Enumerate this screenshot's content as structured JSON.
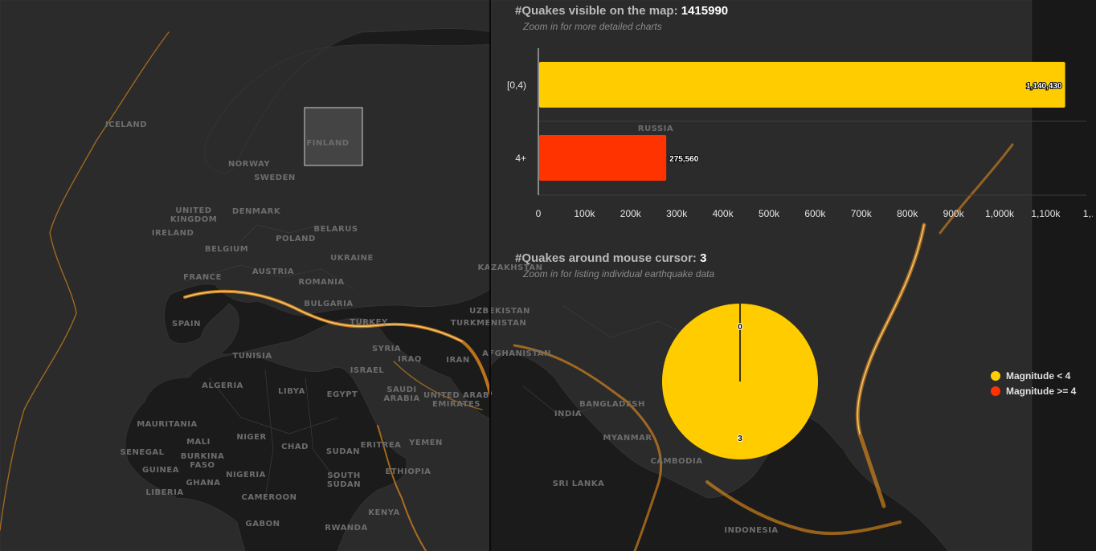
{
  "map": {
    "country_labels": [
      "ICELAND",
      "FINLAND",
      "NORWAY",
      "SWEDEN",
      "RUSSIA",
      "UNITED KINGDOM",
      "IRELAND",
      "DENMARK",
      "BELARUS",
      "POLAND",
      "BELGIUM",
      "UKRAINE",
      "FRANCE",
      "AUSTRIA",
      "ROMANIA",
      "BULGARIA",
      "SPAIN",
      "TURKEY",
      "TUNISIA",
      "SYRIA",
      "IRAQ",
      "IRAN",
      "ISRAEL",
      "ALGERIA",
      "LIBYA",
      "EGYPT",
      "SAUDI ARABIA",
      "UNITED ARAB EMIRATES",
      "MAURITANIA",
      "MALI",
      "NIGER",
      "CHAD",
      "SUDAN",
      "ERITREA",
      "YEMEN",
      "SENEGAL",
      "GUINEA",
      "BURKINA FASO",
      "GHANA",
      "NIGERIA",
      "ETHIOPIA",
      "SOUTH SUDAN",
      "LIBERIA",
      "CAMEROON",
      "KENYA",
      "GABON",
      "RWANDA",
      "KAZAKHSTAN",
      "UZBEKISTAN",
      "TURKMENISTAN",
      "AFGHANISTAN",
      "INDIA",
      "BANGLADESH",
      "MYANMAR",
      "CAMBODIA",
      "SRI LANKA",
      "INDONESIA"
    ],
    "colors": {
      "land": "#2b2b2b",
      "ocean": "#1b1b1b",
      "quake_glow": "#ff9a1a"
    }
  },
  "bar_panel": {
    "title_prefix": "#Quakes visible on the map: ",
    "title_count": "1415990",
    "subtitle": "Zoom in for more detailed charts"
  },
  "pie_panel": {
    "title_prefix": "#Quakes around mouse cursor: ",
    "title_count": "3",
    "subtitle": "Zoom in for listing individual earthquake data"
  },
  "chart_data": [
    {
      "type": "bar",
      "orientation": "horizontal",
      "categories": [
        "[0,4)",
        "4+"
      ],
      "values": [
        1140430,
        275560
      ],
      "value_labels": [
        "1,140,430",
        "275,560"
      ],
      "colors": [
        "#ffcc00",
        "#ff3300"
      ],
      "xlim": [
        0,
        1200000
      ],
      "xticks": [
        "0",
        "100k",
        "200k",
        "300k",
        "400k",
        "500k",
        "600k",
        "700k",
        "800k",
        "900k",
        "1,000k",
        "1,100k",
        "1,…"
      ],
      "grid": true
    },
    {
      "type": "pie",
      "categories": [
        "Magnitude < 4",
        "Magnitude >= 4"
      ],
      "values": [
        3,
        0
      ],
      "value_labels": [
        "3",
        "0"
      ],
      "colors": [
        "#ffcc00",
        "#ff3300"
      ],
      "legend": "right"
    }
  ]
}
